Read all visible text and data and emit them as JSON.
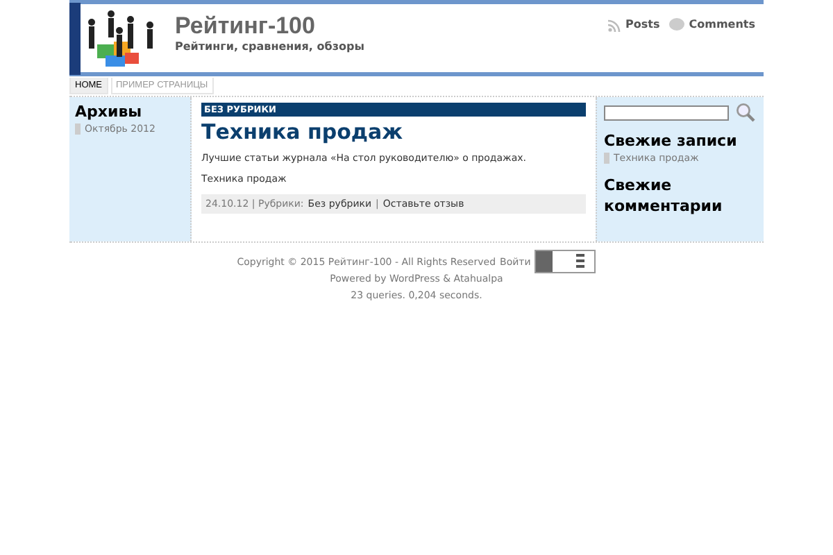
{
  "header": {
    "site_title": "Рейтинг-100",
    "tagline": "Рейтинги, сравнения, обзоры",
    "feeds": [
      {
        "kind": "rss",
        "label": "Posts"
      },
      {
        "kind": "comment",
        "label": "Comments"
      }
    ]
  },
  "nav": {
    "tabs": [
      {
        "label": "HOME",
        "selected": true
      },
      {
        "label": "ПРИМЕР СТРАНИЦЫ",
        "selected": false
      }
    ]
  },
  "left_sidebar": {
    "title": "Архивы",
    "items": [
      "Октябрь 2012"
    ]
  },
  "post": {
    "category": "БЕЗ РУБРИКИ",
    "title": "Техника продаж",
    "paragraphs": [
      "Лучшие статьи журнала «На стол руководителю» о продажах.",
      "Техника продаж"
    ],
    "meta": {
      "date": "24.10.12 | Рубрики:",
      "category_link": "Без рубрики",
      "separator": "|",
      "comment_link": "Оставьте отзыв"
    }
  },
  "right_sidebar": {
    "recent_posts_title": "Свежие записи",
    "recent_posts": [
      "Техника продаж"
    ],
    "recent_comments_title": "Свежие комментарии"
  },
  "footer": {
    "copyright": "Copyright © 2015 Рейтинг-100 - All Rights Reserved",
    "login_link": "Войти",
    "powered": "Powered by WordPress & Atahualpa",
    "stats": "23 queries. 0,204 seconds."
  }
}
